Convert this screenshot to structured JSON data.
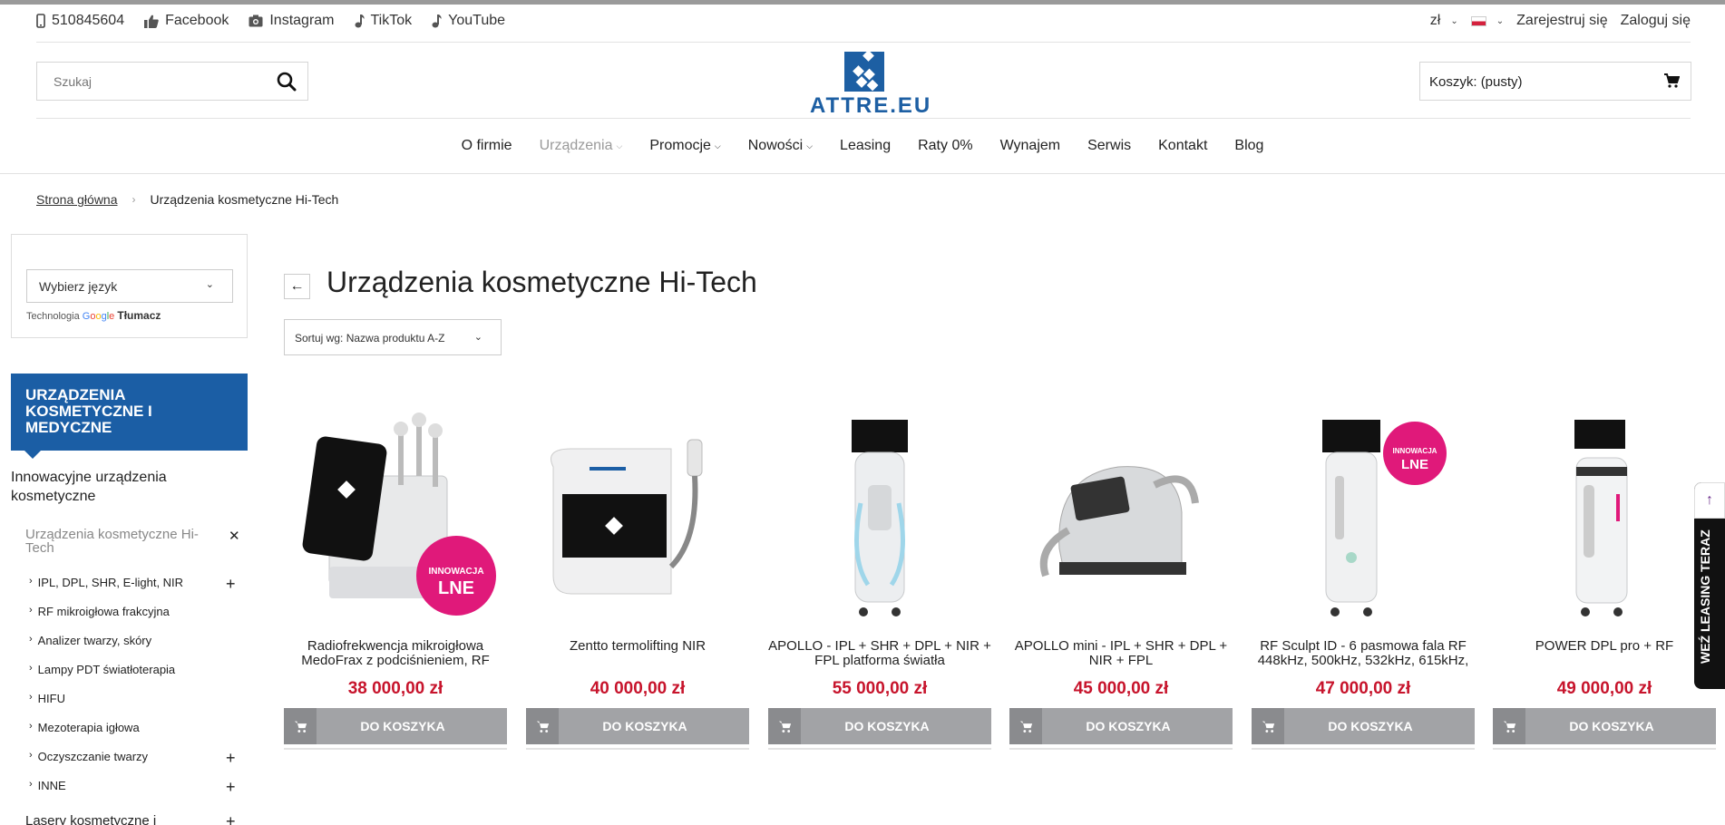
{
  "topbar": {
    "phone": "510845604",
    "social": [
      {
        "label": "Facebook",
        "icon": "thumbs-up-icon"
      },
      {
        "label": "Instagram",
        "icon": "camera-icon"
      },
      {
        "label": "TikTok",
        "icon": "music-note-icon"
      },
      {
        "label": "YouTube",
        "icon": "music-note-icon"
      }
    ],
    "currency": "zł",
    "register": "Zarejestruj się",
    "login": "Zaloguj się"
  },
  "header": {
    "search_placeholder": "Szukaj",
    "logo_text": "ATTRE.EU",
    "cart_label": "Koszyk:",
    "cart_value": "(pusty)"
  },
  "nav": {
    "items": [
      "O firmie",
      "Urządzenia",
      "Promocje",
      "Nowości",
      "Leasing",
      "Raty 0%",
      "Wynajem",
      "Serwis",
      "Kontakt",
      "Blog"
    ]
  },
  "breadcrumb": {
    "home": "Strona główna",
    "current": "Urządzenia kosmetyczne Hi-Tech"
  },
  "sidebar": {
    "language_select": "Wybierz język",
    "powered_prefix": "Technologia",
    "powered_google": "Google",
    "powered_translate": "Tłumacz",
    "category_title": "URZĄDZENIA KOSMETYCZNE I MEDYCZNE",
    "section": "Innowacyjne urządzenia kosmetyczne",
    "active_sub": "Urządzenia kosmetyczne Hi-Tech",
    "subitems": [
      "IPL, DPL, SHR, E-light, NIR",
      "RF mikroigłowa frakcyjna",
      "Analizer twarzy, skóry",
      "Lampy PDT światłoterapia",
      "HIFU",
      "Mezoterapia igłowa",
      "Oczyszczanie twarzy",
      "INNE"
    ],
    "next_section": "Lasery kosmetyczne i"
  },
  "main": {
    "title": "Urządzenia kosmetyczne Hi-Tech",
    "sort_label": "Sortuj wg: Nazwa produktu A-Z",
    "add_to_cart": "DO KOSZYKA",
    "badge_line1": "INNOWACJA",
    "badge_line2": "LNE",
    "products": [
      {
        "name": "Radiofrekwencja mikroigłowa MedoFrax z podciśnieniem, RF",
        "price": "38 000,00 zł"
      },
      {
        "name": "Zentto termolifting NIR",
        "price": "40 000,00 zł"
      },
      {
        "name": "APOLLO - IPL + SHR + DPL + NIR + FPL platforma światła",
        "price": "55 000,00 zł"
      },
      {
        "name": "APOLLO mini - IPL + SHR + DPL + NIR + FPL",
        "price": "45 000,00 zł"
      },
      {
        "name": "RF Sculpt ID - 6 pasmowa fala RF 448kHz, 500kHz, 532kHz, 615kHz,",
        "price": "47 000,00 zł"
      },
      {
        "name": "POWER DPL pro + RF",
        "price": "49 000,00 zł"
      }
    ]
  },
  "leasing_tab": "WEŹ LEASING TERAZ",
  "colors": {
    "brand_blue": "#1b5ea5",
    "price_red": "#c7142c",
    "button_gray": "#a2a3a6",
    "badge_pink": "#e0197a"
  }
}
